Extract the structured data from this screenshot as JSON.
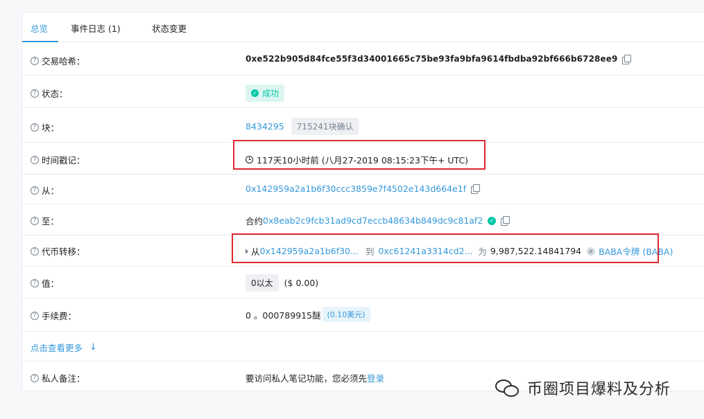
{
  "tabs": [
    "总览",
    "事件日志 (1)",
    "状态变更"
  ],
  "rows": {
    "tx_hash": {
      "label": "交易哈希：",
      "value": "0xe522b905d84fce55f3d34001665c75be93fa9bfa9614fbdba92bf666b6728ee9"
    },
    "status": {
      "label": "状态：",
      "value": "成功"
    },
    "block": {
      "label": "块：",
      "value": "8434295",
      "confirmations": "715241块确认"
    },
    "timestamp": {
      "label": "时间戳记：",
      "value": "117天10小时前 (八月27-2019 08:15:23下午+ UTC)"
    },
    "from": {
      "label": "从：",
      "value": "0x142959a2a1b6f30ccc3859e7f4502e143d664e1f"
    },
    "to": {
      "label": "至：",
      "prefix": "合约",
      "value": "0x8eab2c9fcb31ad9cd7eccb48634b849dc9c81af2"
    },
    "token_transfer": {
      "label": "代币转移：",
      "from_prefix": "从",
      "from": "0x142959a2a1b6f30...",
      "to_prefix": "到",
      "to": "0xc61241a3314cd2...",
      "amount_prefix": "为",
      "amount": "9,987,522.14841794",
      "token": "BABA令牌 (BABA)"
    },
    "value": {
      "label": "值：",
      "value": "0以太",
      "usd": "($ 0.00)"
    },
    "fee": {
      "label": "手续费：",
      "value": "0 。000789915醚",
      "usd": "(0.10美元)"
    },
    "more": {
      "label": "点击查看更多"
    },
    "note": {
      "label": "私人备注：",
      "text": "要访问私人笔记功能，您必须先",
      "link": "登录"
    }
  },
  "watermark": "币圈项目爆料及分析",
  "colors": {
    "accent": "#3498db",
    "success": "#00c9a7",
    "highlight": "#e0282e"
  }
}
